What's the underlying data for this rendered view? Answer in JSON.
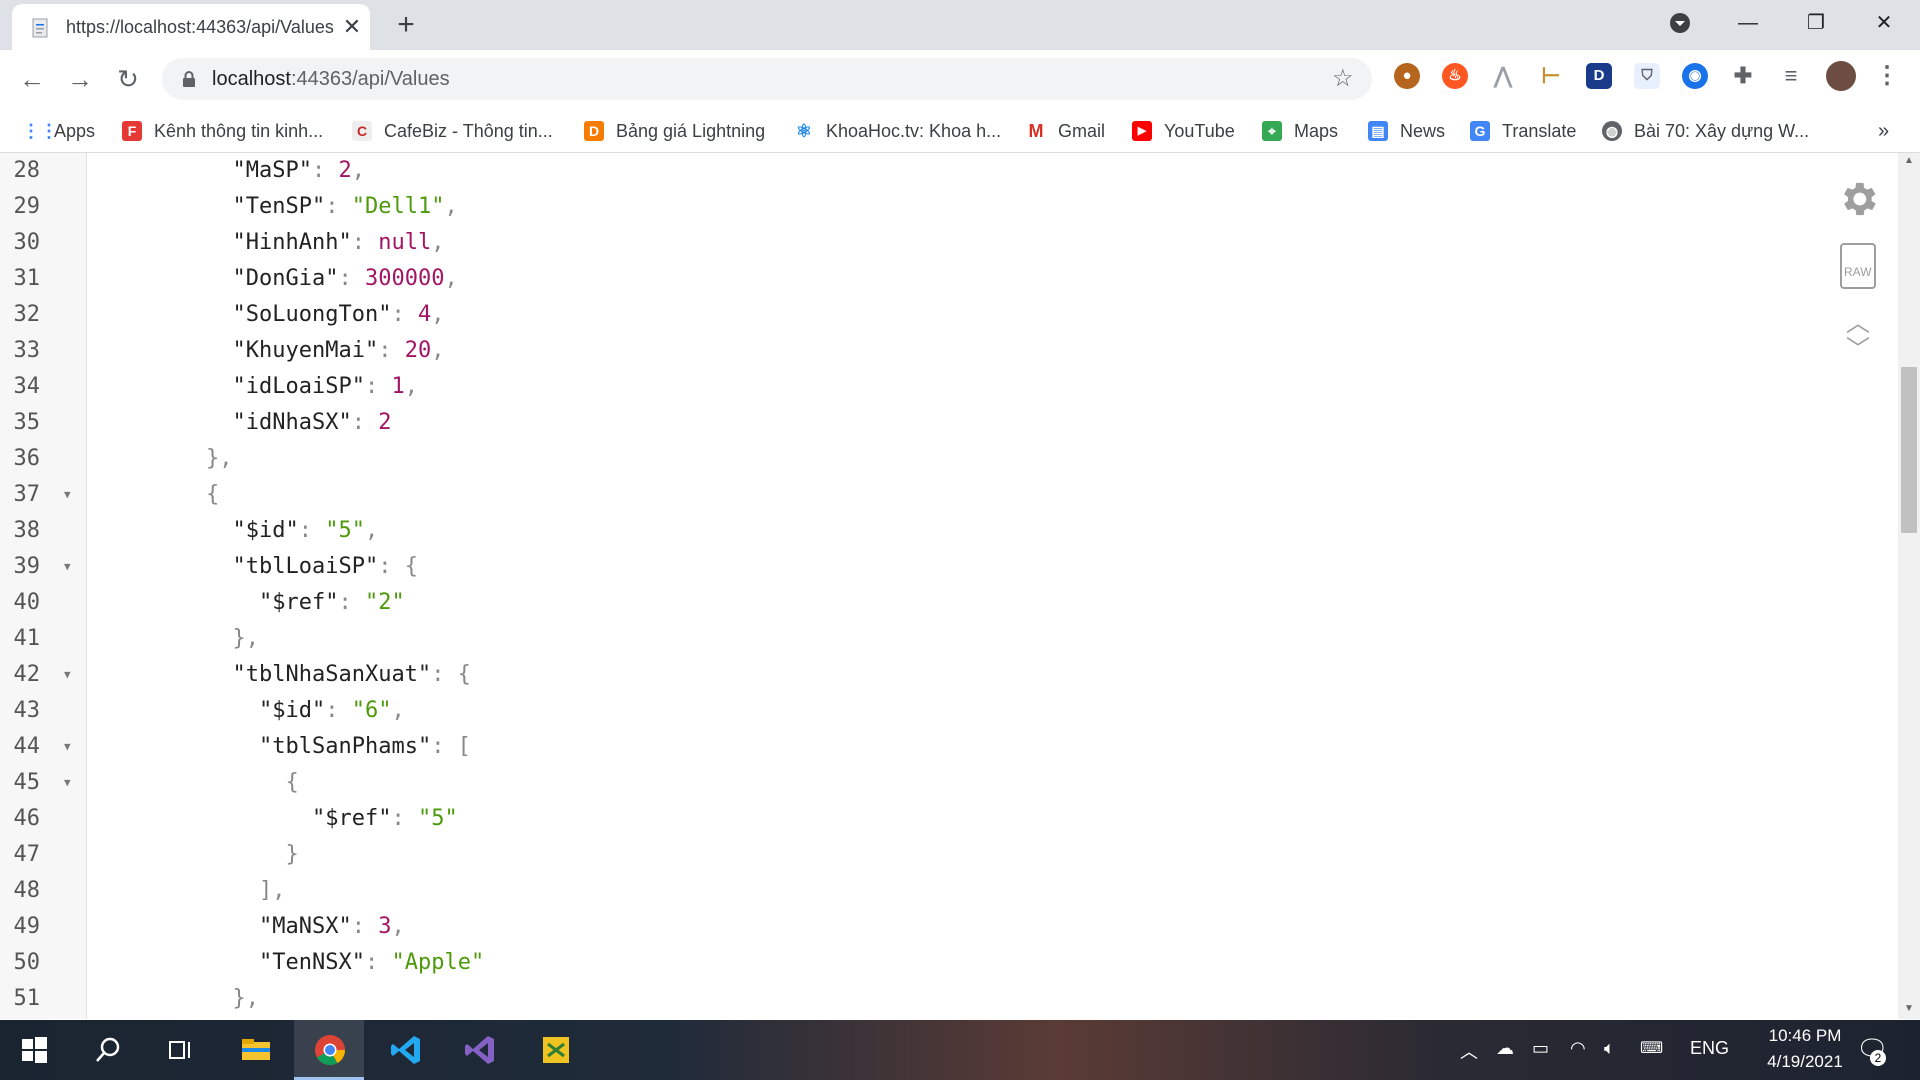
{
  "browser": {
    "tab_title": "https://localhost:44363/api/Values",
    "url_host": "localhost",
    "url_path": ":44363/api/Values"
  },
  "bookmarks": [
    {
      "label": "Apps",
      "color": "#4285f4"
    },
    {
      "label": "Kênh thông tin kinh...",
      "color": "#e53935"
    },
    {
      "label": "CafeBiz - Thông tin...",
      "color": "#c62828"
    },
    {
      "label": "Bảng giá Lightning",
      "color": "#f57c00"
    },
    {
      "label": "KhoaHoc.tv: Khoa h...",
      "color": "#1e88e5"
    },
    {
      "label": "Gmail",
      "color": "#d93025"
    },
    {
      "label": "YouTube",
      "color": "#ff0000"
    },
    {
      "label": "Maps",
      "color": "#34a853"
    },
    {
      "label": "News",
      "color": "#4285f4"
    },
    {
      "label": "Translate",
      "color": "#4285f4"
    },
    {
      "label": "Bài 70: Xây dựng W...",
      "color": "#5f6368"
    }
  ],
  "json_lines": [
    {
      "n": "28",
      "fold": false,
      "indent": 4,
      "tokens": [
        [
          "k",
          "\"MaSP\""
        ],
        [
          "p",
          ": "
        ],
        [
          "n",
          "2"
        ],
        [
          "p",
          ","
        ]
      ]
    },
    {
      "n": "29",
      "fold": false,
      "indent": 4,
      "tokens": [
        [
          "k",
          "\"TenSP\""
        ],
        [
          "p",
          ": "
        ],
        [
          "s",
          "\"Dell1\""
        ],
        [
          "p",
          ","
        ]
      ]
    },
    {
      "n": "30",
      "fold": false,
      "indent": 4,
      "tokens": [
        [
          "k",
          "\"HinhAnh\""
        ],
        [
          "p",
          ": "
        ],
        [
          "n",
          "null"
        ],
        [
          "p",
          ","
        ]
      ]
    },
    {
      "n": "31",
      "fold": false,
      "indent": 4,
      "tokens": [
        [
          "k",
          "\"DonGia\""
        ],
        [
          "p",
          ": "
        ],
        [
          "n",
          "300000"
        ],
        [
          "p",
          ","
        ]
      ]
    },
    {
      "n": "32",
      "fold": false,
      "indent": 4,
      "tokens": [
        [
          "k",
          "\"SoLuongTon\""
        ],
        [
          "p",
          ": "
        ],
        [
          "n",
          "4"
        ],
        [
          "p",
          ","
        ]
      ]
    },
    {
      "n": "33",
      "fold": false,
      "indent": 4,
      "tokens": [
        [
          "k",
          "\"KhuyenMai\""
        ],
        [
          "p",
          ": "
        ],
        [
          "n",
          "20"
        ],
        [
          "p",
          ","
        ]
      ]
    },
    {
      "n": "34",
      "fold": false,
      "indent": 4,
      "tokens": [
        [
          "k",
          "\"idLoaiSP\""
        ],
        [
          "p",
          ": "
        ],
        [
          "n",
          "1"
        ],
        [
          "p",
          ","
        ]
      ]
    },
    {
      "n": "35",
      "fold": false,
      "indent": 4,
      "tokens": [
        [
          "k",
          "\"idNhaSX\""
        ],
        [
          "p",
          ": "
        ],
        [
          "n",
          "2"
        ]
      ]
    },
    {
      "n": "36",
      "fold": false,
      "indent": 3,
      "tokens": [
        [
          "p",
          "},"
        ]
      ]
    },
    {
      "n": "37",
      "fold": true,
      "indent": 3,
      "tokens": [
        [
          "p",
          "{"
        ]
      ]
    },
    {
      "n": "38",
      "fold": false,
      "indent": 4,
      "tokens": [
        [
          "k",
          "\"$id\""
        ],
        [
          "p",
          ": "
        ],
        [
          "s",
          "\"5\""
        ],
        [
          "p",
          ","
        ]
      ]
    },
    {
      "n": "39",
      "fold": true,
      "indent": 4,
      "tokens": [
        [
          "k",
          "\"tblLoaiSP\""
        ],
        [
          "p",
          ": {"
        ]
      ]
    },
    {
      "n": "40",
      "fold": false,
      "indent": 5,
      "tokens": [
        [
          "k",
          "\"$ref\""
        ],
        [
          "p",
          ": "
        ],
        [
          "s",
          "\"2\""
        ]
      ]
    },
    {
      "n": "41",
      "fold": false,
      "indent": 4,
      "tokens": [
        [
          "p",
          "},"
        ]
      ]
    },
    {
      "n": "42",
      "fold": true,
      "indent": 4,
      "tokens": [
        [
          "k",
          "\"tblNhaSanXuat\""
        ],
        [
          "p",
          ": {"
        ]
      ]
    },
    {
      "n": "43",
      "fold": false,
      "indent": 5,
      "tokens": [
        [
          "k",
          "\"$id\""
        ],
        [
          "p",
          ": "
        ],
        [
          "s",
          "\"6\""
        ],
        [
          "p",
          ","
        ]
      ]
    },
    {
      "n": "44",
      "fold": true,
      "indent": 5,
      "tokens": [
        [
          "k",
          "\"tblSanPhams\""
        ],
        [
          "p",
          ": ["
        ]
      ]
    },
    {
      "n": "45",
      "fold": true,
      "indent": 6,
      "tokens": [
        [
          "p",
          "{"
        ]
      ]
    },
    {
      "n": "46",
      "fold": false,
      "indent": 7,
      "tokens": [
        [
          "k",
          "\"$ref\""
        ],
        [
          "p",
          ": "
        ],
        [
          "s",
          "\"5\""
        ]
      ]
    },
    {
      "n": "47",
      "fold": false,
      "indent": 6,
      "tokens": [
        [
          "p",
          "}"
        ]
      ]
    },
    {
      "n": "48",
      "fold": false,
      "indent": 5,
      "tokens": [
        [
          "p",
          "],"
        ]
      ]
    },
    {
      "n": "49",
      "fold": false,
      "indent": 5,
      "tokens": [
        [
          "k",
          "\"MaNSX\""
        ],
        [
          "p",
          ": "
        ],
        [
          "n",
          "3"
        ],
        [
          "p",
          ","
        ]
      ]
    },
    {
      "n": "50",
      "fold": false,
      "indent": 5,
      "tokens": [
        [
          "k",
          "\"TenNSX\""
        ],
        [
          "p",
          ": "
        ],
        [
          "s",
          "\"Apple\""
        ]
      ]
    },
    {
      "n": "51",
      "fold": false,
      "indent": 4,
      "tokens": [
        [
          "p",
          "},"
        ]
      ]
    }
  ],
  "viewer_tools": {
    "raw_label": "RAW"
  },
  "taskbar": {
    "language": "ENG",
    "time": "10:46 PM",
    "date": "4/19/2021",
    "notification_count": "2"
  }
}
